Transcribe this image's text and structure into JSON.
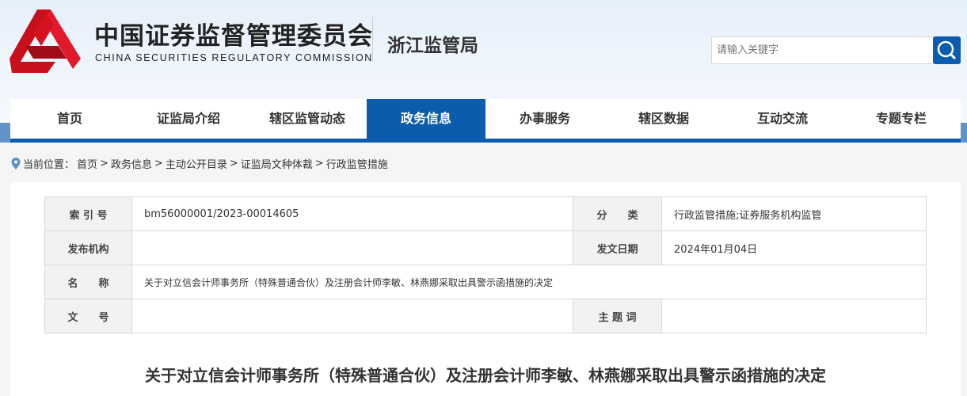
{
  "header": {
    "title_cn": "中国证券监督管理委员会",
    "title_en": "CHINA SECURITIES REGULATORY COMMISSION",
    "bureau": "浙江监管局",
    "search_placeholder": "请输入关键字"
  },
  "nav": [
    "首页",
    "证监局介绍",
    "辖区监管动态",
    "政务信息",
    "办事服务",
    "辖区数据",
    "互动交流",
    "专题专栏"
  ],
  "breadcrumb": {
    "label": "当前位置：",
    "items": [
      "首页",
      "政务信息",
      "主动公开目录",
      "证监局文种体裁",
      "行政监管措施"
    ],
    "sep": ">"
  },
  "meta": {
    "index_label": "索 引 号",
    "index": "bm56000001/2023-00014605",
    "category_label": "分　　类",
    "category": "行政监管措施;证券服务机构监管",
    "publisher_label": "发布机构",
    "publisher": "",
    "date_label": "发文日期",
    "date": "2024年01月04日",
    "name_label": "名　　称",
    "name": "关于对立信会计师事务所（特殊普通合伙）及注册会计师李敏、林燕娜采取出具警示函措施的决定",
    "docno_label": "文　　号",
    "docno": "",
    "keywords_label": "主 题 词",
    "keywords": ""
  },
  "article": {
    "title": "关于对立信会计师事务所（特殊普通合伙）及注册会计师李敏、林燕娜采取出具警示函措施的决定"
  }
}
